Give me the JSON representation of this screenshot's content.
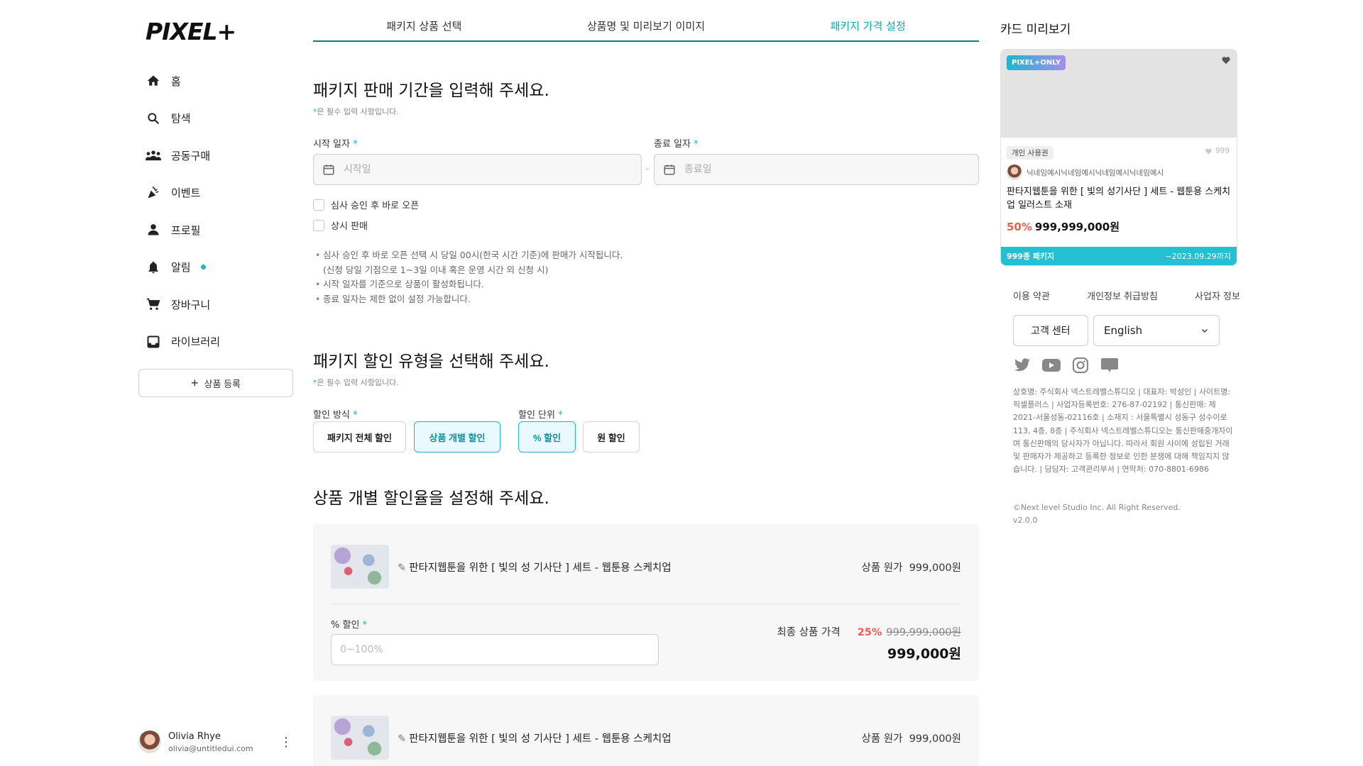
{
  "sidebar": {
    "logo": "PIXEL+",
    "nav": [
      {
        "label": "홈",
        "icon": "home-icon"
      },
      {
        "label": "탐색",
        "icon": "search-icon"
      },
      {
        "label": "공동구매",
        "icon": "group-icon"
      },
      {
        "label": "이벤트",
        "icon": "party-icon"
      },
      {
        "label": "프로필",
        "icon": "person-icon"
      },
      {
        "label": "알림",
        "icon": "bell-icon"
      },
      {
        "label": "장바구니",
        "icon": "cart-icon"
      },
      {
        "label": "라이브러리",
        "icon": "library-icon"
      }
    ],
    "register_label": "상품 등록",
    "user": {
      "name": "Olivia Rhye",
      "email": "olivia@untitledui.com"
    }
  },
  "tabs": [
    {
      "label": "패키지 상품 선택",
      "active": false
    },
    {
      "label": "상품명 및 미리보기 이미지",
      "active": false
    },
    {
      "label": "패키지 가격 설정",
      "active": true
    }
  ],
  "period": {
    "title": "패키지 판매 기간을 입력해 주세요.",
    "required_note": "은 필수 입력 사항입니다.",
    "start_label": "시작 일자",
    "start_placeholder": "시작일",
    "end_label": "종료 일자",
    "end_placeholder": "종료일",
    "option1": "심사 승인 후 바로 오픈",
    "option2": "상시 판매",
    "notes": [
      "심사 승인 후 바로 오픈 선택 시 당일 00시(한국 시간 기준)에 판매가 시작됩니다.",
      "(신청 당일 기점으로 1~3일 이내 혹은 운영 시간 외 신청 시)",
      "시작 일자를 기준으로 상품이 활성화됩니다.",
      "종료 일자는 제한 없이 설정 가능합니다."
    ]
  },
  "discount": {
    "title": "패키지 할인 유형을 선택해 주세요.",
    "required_note": "은 필수 입력 사항입니다.",
    "method_label": "할인 방식",
    "method_options": [
      "패키지 전체 할인",
      "상품 개별 할인"
    ],
    "method_selected": "상품 개별 할인",
    "unit_label": "할인 단위",
    "unit_options": [
      "% 할인",
      "원 할인"
    ],
    "unit_selected": "% 할인"
  },
  "rates": {
    "title": "상품 개별 할인율을 설정해 주세요.",
    "items": [
      {
        "name": "판타지웹툰을 위한 [ 빛의 성 기사단 ] 세트 - 웹툰용 스케치업",
        "price_label": "상품 원가",
        "price": "999,000원",
        "pct_label": "% 할인",
        "pct_placeholder": "0~100%",
        "final_label": "최종 상품 가격",
        "final_pct": "25%",
        "final_orig": "999,999,000원",
        "final_price": "999,000원"
      },
      {
        "name": "판타지웹툰을 위한 [ 빛의 성 기사단 ] 세트 - 웹툰용 스케치업",
        "price_label": "상품 원가",
        "price": "999,000원"
      }
    ]
  },
  "preview": {
    "title": "카드 미리보기",
    "badge": "PIXEL+ONLY",
    "chip": "개인 사용권",
    "likes": "999",
    "seller": "닉네임예시닉네임예시닉네임예시닉네임예시",
    "product_title": "판타지웹툰을 위한 [ 빛의 성기사단 ] 세트 - 웹툰용 스케치업 일러스트 소재",
    "discount_pct": "50%",
    "price": "999,999,000원",
    "count": "999종 패키지",
    "until": "~2023.09.29까지"
  },
  "footer": {
    "links": [
      "이용 약관",
      "개인정보 취급방침",
      "사업자 정보"
    ],
    "cs_label": "고객 센터",
    "language": "English",
    "socials": [
      "twitter-icon",
      "youtube-icon",
      "instagram-icon",
      "blog-icon"
    ],
    "company_info": "상호명: 주식회사 넥스트레벨스튜디오 | 대표자: 박성인 | 사이트명: 픽셀플러스 | 사업자등록번호: 276-87-02192 | 통신판매: 제 2021-서울성동-02116호 | 소재지 : 서울특별시 성동구 성수이로 113, 4층, 8층 | 주식회사 넥스트레벨스튜디오는 통신판매중개자이며 통신판매의 당사자가 아닙니다. 따라서 회원 사이에 성립된 거래 및 판매자가 제공하고 등록한 정보로 인한 분쟁에 대해 책임지지 않습니다. | 담당자: 고객관리부서 | 연락처: 070-8801-6986",
    "copyright": "©Next level Studio Inc. All Right Reserved.",
    "version": "v2.0.0"
  },
  "colors": {
    "accent": "#1bb7cf",
    "tab_line": "#0f7f86",
    "discount": "#f05a4f"
  }
}
